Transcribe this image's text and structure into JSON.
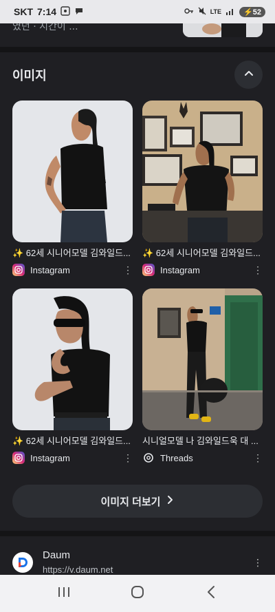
{
  "status_bar": {
    "carrier": "SKT",
    "time": "7:14",
    "network": "LTE",
    "battery": "52"
  },
  "top_snippet": {
    "text": "였던 · 시간이 ..."
  },
  "images_section": {
    "title": "이미지",
    "items": [
      {
        "caption": "✨ 62세 시니어모델 김와일드...",
        "source": "Instagram",
        "source_icon": "instagram-icon"
      },
      {
        "caption": "✨ 62세 시니어모델 김와일드...",
        "source": "Instagram",
        "source_icon": "instagram-icon"
      },
      {
        "caption": "✨ 62세 시니어모델 김와일드...",
        "source": "Instagram",
        "source_icon": "instagram-icon"
      },
      {
        "caption": "시니얼모델 나 김와일드욱 대 ...",
        "source": "Threads",
        "source_icon": "threads-icon"
      }
    ],
    "more_button": "이미지 더보기"
  },
  "result": {
    "title": "Daum",
    "url": "https://v.daum.net"
  },
  "colors": {
    "background": "#1f1f23",
    "instagram": "#d62976",
    "daum_blue": "#1a73e8"
  }
}
